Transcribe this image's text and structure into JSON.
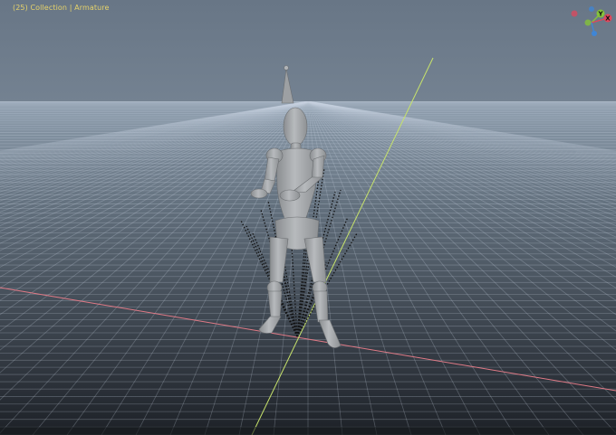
{
  "viewport": {
    "frame_label": "(25)",
    "collection_label": "Collection",
    "separator": "|",
    "object_label": "Armature"
  },
  "gizmo": {
    "x_label": "X",
    "y_label": "Y",
    "colors": {
      "x_axis": "#e0475c",
      "y_axis": "#85c23a",
      "z_axis": "#3f86d6"
    }
  },
  "colors": {
    "sky_top": "#6d7c8c",
    "sky_bottom": "#9aa9b8",
    "floor_near": "#1f2329",
    "floor_far": "#8fa0b0",
    "grid": "#c9d5e2",
    "x_axis_line": "#e07a86",
    "y_axis_line": "#c7e36b",
    "model": "#a5a8ab"
  }
}
